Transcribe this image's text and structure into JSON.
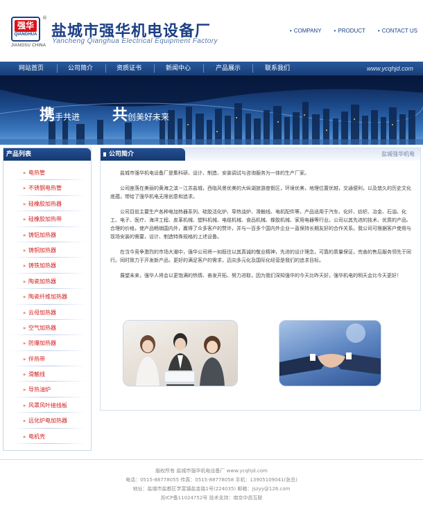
{
  "header": {
    "logo_text": "强华",
    "logo_en": "QIANGHUA",
    "logo_reg": "®",
    "logo_sub": "JIANGSU CHINA",
    "company_cn": "盐城市强华机电设备厂",
    "company_en": "Yancheng Qianghua Electrical Equipment Factory",
    "links": [
      "COMPANY",
      "PRODUCT",
      "CONTACT US"
    ]
  },
  "nav": {
    "items": [
      "网站首页",
      "公司简介",
      "资质证书",
      "新闻中心",
      "产品展示",
      "联系我们"
    ],
    "domain": "www.ycqhjd.com"
  },
  "banner": {
    "slogan1_big": "携",
    "slogan1_rest": "手共进",
    "slogan2_big": "共",
    "slogan2_rest": "创美好未来"
  },
  "sidebar": {
    "title": "产品列表",
    "items": [
      "电热管",
      "不锈钢电热管",
      "硅橡胶加热器",
      "硅橡胶加热带",
      "铸铝加热器",
      "铸铜加热器",
      "铸铁加热器",
      "陶瓷加热器",
      "陶瓷纤维加热器",
      "云母加热器",
      "空气加热器",
      "防爆加热器",
      "伴热带",
      "滑触线",
      "导热油炉",
      "风罩风叶接线板",
      "远化炉电加热器",
      "电机壳"
    ]
  },
  "main": {
    "tab_title": "公司简介",
    "crumb": "盐城强华机电",
    "paragraphs": [
      "盐城市强华机电设备厂是集科研、设计、制造、安装调试与咨询服务为一体的生产厂家。",
      "公司座落在美丽的黄海之滨－江苏盐城，西临风景优美的大纵湖旅游度假区，环境优美，地理位置优越，交通便利，以及悠久的历史文化底蕴，带给了强华机电无限创意和追求。",
      "公司目前主要生产各种电加热器系列、硅胶活化炉、导热油炉、滑触线、电机配件等，产品适用于汽车、化纤、纺织、冶金、石油、化工、电子、医疗、海洋工程、皮革机械、塑料机械、电缆机械、食品机械、橡胶机械、家用电器等行业。公司以其先进的技术、优质的产品、合理的价格，使产品畅销国内外，赢得了众多客户的赞许，并与一百多个国内外企业一直保持长期友好的合作关系。我公司可根据客户使用与现场安装的需要，设计、制造特殊规格的上述设备。",
      "在当今竞争激烈的市场大潮中，强华公司将一如既往以其真诚的敬业精神，先进的设计理念，可靠的质量保证，完善的售后服务领先于同行。同时致力于开发新产品，更好的满足客户的需求，迈向多元化及国际化经营是我们的追求目标。",
      "展望未来，强华人将会以更饱满的热情、奋发开拓、努力进取，因为我们深知强华的今天比昨天好，强华机电的明天会比今天更好！"
    ]
  },
  "footer": {
    "lines": [
      "版权所有  盐城市强华机电设备厂  www.ycqhjd.com",
      "电话：0515-88778055  传真：0515-88778058  手机：13905109041(张总)",
      "地址：盐城市盐都区学富镇盐金路1号(224035)  邮箱：jszyy@126.com",
      "苏ICP备11024752号  技术支持：南京中邑互联"
    ]
  },
  "colors": {
    "brand_blue": "#1b3f86",
    "nav_blue": "#163d78",
    "link_red": "#d31b1b"
  }
}
